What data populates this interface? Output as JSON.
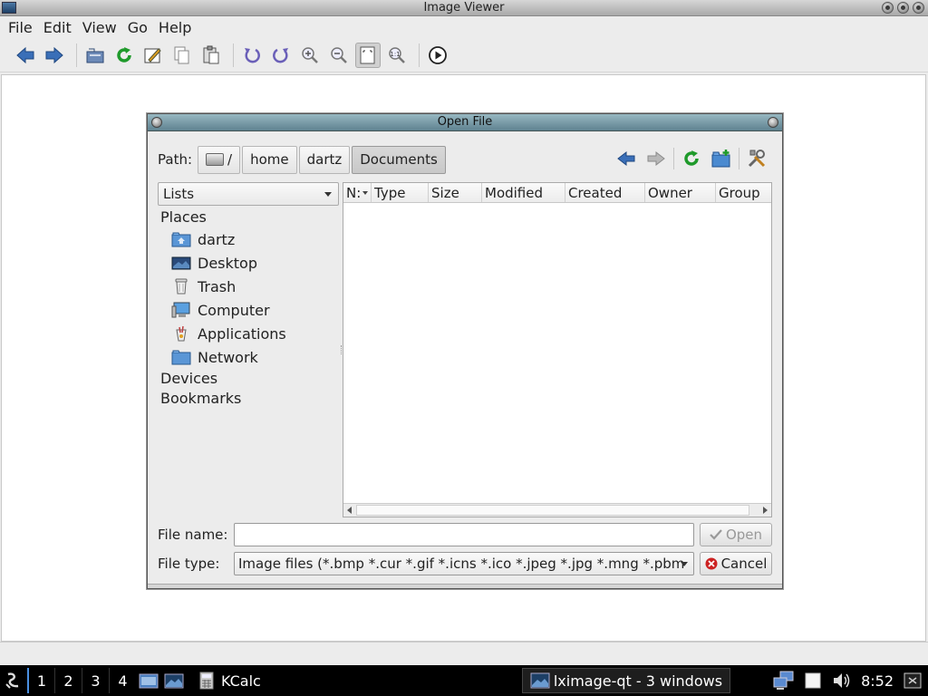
{
  "window": {
    "title": "Image Viewer",
    "app_icon": "image-viewer-icon",
    "controls": [
      "minimize-icon",
      "maximize-icon",
      "close-icon"
    ]
  },
  "menubar": {
    "items": [
      {
        "label": "File"
      },
      {
        "label": "Edit"
      },
      {
        "label": "View"
      },
      {
        "label": "Go"
      },
      {
        "label": "Help"
      }
    ]
  },
  "toolbar": {
    "buttons": [
      "back-arrow-icon",
      "forward-arrow-icon",
      "open-folder-icon",
      "reload-icon",
      "edit-icon",
      "copy-icon",
      "paste-icon",
      "rotate-ccw-icon",
      "rotate-cw-icon",
      "zoom-in-icon",
      "zoom-out-icon",
      "fit-window-icon",
      "original-size-icon",
      "slideshow-icon"
    ],
    "active_button": "fit-window-icon"
  },
  "dialog": {
    "title": "Open File",
    "path_label": "Path:",
    "breadcrumbs": [
      "/",
      "home",
      "dartz",
      "Documents"
    ],
    "current_crumb": "Documents",
    "nav_icons": [
      "back-arrow-icon",
      "forward-arrow-icon",
      "reload-icon",
      "new-folder-icon",
      "settings-tools-icon"
    ],
    "view_mode": "Lists",
    "places": {
      "heading": "Places",
      "items": [
        {
          "label": "dartz",
          "icon": "home-folder-icon"
        },
        {
          "label": "Desktop",
          "icon": "desktop-icon"
        },
        {
          "label": "Trash",
          "icon": "trash-icon"
        },
        {
          "label": "Computer",
          "icon": "computer-icon"
        },
        {
          "label": "Applications",
          "icon": "applications-icon"
        },
        {
          "label": "Network",
          "icon": "network-folder-icon"
        }
      ],
      "devices": "Devices",
      "bookmarks": "Bookmarks"
    },
    "columns": [
      "N:",
      "Type",
      "Size",
      "Modified",
      "Created",
      "Owner",
      "Group"
    ],
    "file_name_label": "File name:",
    "file_name_value": "",
    "file_type_label": "File type:",
    "file_type_value": "Image files (*.bmp *.cur *.gif *.icns *.ico *.jpeg *.jpg *.mng *.pbm",
    "open_label": "Open",
    "cancel_label": "Cancel"
  },
  "taskbar": {
    "desktops": [
      "1",
      "2",
      "3",
      "4"
    ],
    "active_desktop": "1",
    "tasks": [
      {
        "label": "KCalc",
        "icon": "calculator-icon"
      },
      {
        "label": "lximage-qt - 3 windows",
        "icon": "image-viewer-icon"
      }
    ],
    "clock": "8:52",
    "tray_icons": [
      "network-icon",
      "clipboard-icon",
      "volume-icon",
      "power-icon"
    ]
  },
  "colors": {
    "dialog_titlebar": "#6f909c",
    "taskbar": "#000000",
    "accent": "#4a90e2",
    "cancel_red": "#cc2222",
    "open_check": "#999999"
  }
}
